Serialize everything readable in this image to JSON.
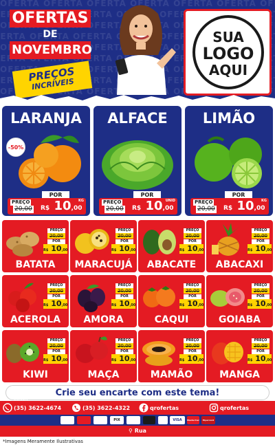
{
  "header": {
    "title_line1": "OFERTAS",
    "title_line2": "DE",
    "title_line3": "NOVEMBRO",
    "subtitle_line1": "PREÇOS",
    "subtitle_line2": "INCRÍVEIS",
    "background_word": "OFERTA",
    "logo_line1": "SUA",
    "logo_line2": "LOGO",
    "logo_line3": "AQUI"
  },
  "featured": [
    {
      "name": "LARANJA",
      "preco_label": "PREÇO",
      "por_label": "POR",
      "old_price": "20,00",
      "currency": "R$",
      "new_price_int": "10",
      "new_price_dec": ",00",
      "unit": "KG",
      "badge": "-50%"
    },
    {
      "name": "ALFACE",
      "preco_label": "PREÇO",
      "por_label": "POR",
      "old_price": "20,00",
      "currency": "R$",
      "new_price_int": "10",
      "new_price_dec": ",00",
      "unit": "UNID"
    },
    {
      "name": "LIMÃO",
      "preco_label": "PREÇO",
      "por_label": "POR",
      "old_price": "20,00",
      "currency": "R$",
      "new_price_int": "10",
      "new_price_dec": ",00",
      "unit": "KG"
    }
  ],
  "grid": [
    {
      "name": "BATATA",
      "icon": "potato",
      "preco_label": "PREÇO",
      "old_price": "20,00",
      "por_label": "POR",
      "currency": "R$",
      "new_price_int": "10",
      "new_price_dec": ",00"
    },
    {
      "name": "MARACUJÁ",
      "icon": "passion-fruit",
      "preco_label": "PREÇO",
      "old_price": "20,00",
      "por_label": "POR",
      "currency": "R$",
      "new_price_int": "10",
      "new_price_dec": ",00"
    },
    {
      "name": "ABACATE",
      "icon": "avocado",
      "preco_label": "PREÇO",
      "old_price": "20,00",
      "por_label": "POR",
      "currency": "R$",
      "new_price_int": "10",
      "new_price_dec": ",00"
    },
    {
      "name": "ABACAXI",
      "icon": "pineapple",
      "preco_label": "PREÇO",
      "old_price": "20,00",
      "por_label": "POR",
      "currency": "R$",
      "new_price_int": "10",
      "new_price_dec": ",00"
    },
    {
      "name": "ACEROLA",
      "icon": "acerola",
      "preco_label": "PREÇO",
      "old_price": "20,00",
      "por_label": "POR",
      "currency": "R$",
      "new_price_int": "10",
      "new_price_dec": ",00"
    },
    {
      "name": "AMORA",
      "icon": "blackberry",
      "preco_label": "PREÇO",
      "old_price": "20,00",
      "por_label": "POR",
      "currency": "R$",
      "new_price_int": "10",
      "new_price_dec": ",00"
    },
    {
      "name": "CAQUI",
      "icon": "persimmon",
      "preco_label": "PREÇO",
      "old_price": "20,00",
      "por_label": "POR",
      "currency": "R$",
      "new_price_int": "10",
      "new_price_dec": ",00"
    },
    {
      "name": "GOIABA",
      "icon": "guava",
      "preco_label": "PREÇO",
      "old_price": "20,00",
      "por_label": "POR",
      "currency": "R$",
      "new_price_int": "10",
      "new_price_dec": ",00"
    },
    {
      "name": "KIWI",
      "icon": "kiwi",
      "preco_label": "PREÇO",
      "old_price": "20,00",
      "por_label": "POR",
      "currency": "R$",
      "new_price_int": "10",
      "new_price_dec": ",00"
    },
    {
      "name": "MAÇA",
      "icon": "apple",
      "preco_label": "PREÇO",
      "old_price": "20,00",
      "por_label": "POR",
      "currency": "R$",
      "new_price_int": "10",
      "new_price_dec": ",00"
    },
    {
      "name": "MAMÃO",
      "icon": "papaya",
      "preco_label": "PREÇO",
      "old_price": "20,00",
      "por_label": "POR",
      "currency": "R$",
      "new_price_int": "10",
      "new_price_dec": ",00"
    },
    {
      "name": "MANGA",
      "icon": "mango",
      "preco_label": "PREÇO",
      "old_price": "20,00",
      "por_label": "POR",
      "currency": "R$",
      "new_price_int": "10",
      "new_price_dec": ",00"
    }
  ],
  "footer": {
    "cta": "Crie seu encarte com este tema!",
    "contacts": [
      {
        "icon": "whatsapp-icon",
        "label": "Delivery",
        "text": "(35) 3622-4674"
      },
      {
        "icon": "phone-icon",
        "label": "Delivery",
        "text": "(35) 3622-4322"
      },
      {
        "icon": "facebook-icon",
        "label": "",
        "text": "qrofertas"
      },
      {
        "icon": "instagram-icon",
        "label": "",
        "text": "qrofertas"
      }
    ],
    "payments": [
      "",
      "",
      "",
      "PIX",
      "",
      "",
      "",
      "VISA",
      "MasterCard",
      "Hipercard"
    ],
    "address": "Rua",
    "disclaimer": "*Imagens Meramente Ilustrativas"
  },
  "colors": {
    "brand_blue": "#1e2e86",
    "brand_red": "#e41b23",
    "brand_yellow": "#ffd400"
  }
}
